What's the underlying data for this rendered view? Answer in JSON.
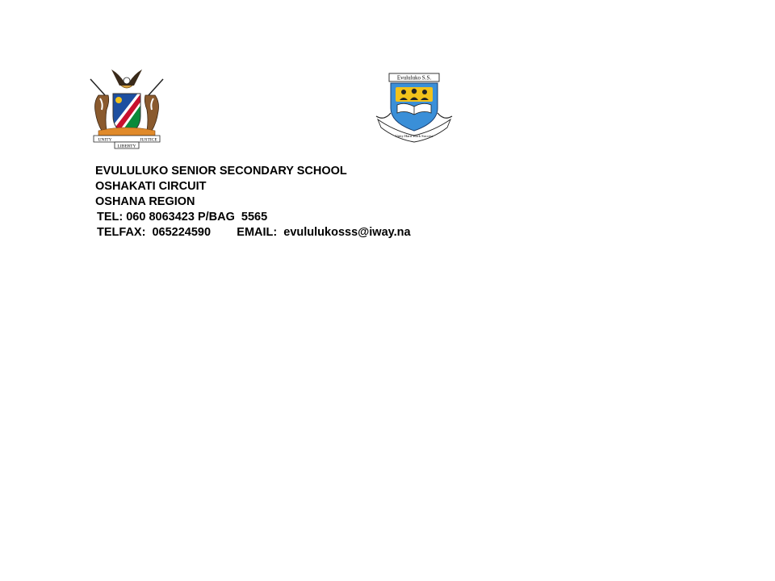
{
  "coat_of_arms": {
    "icon": "namibia-coat-of-arms-icon",
    "motto_left": "UNITY",
    "motto_center": "LIBERTY",
    "motto_right": "JUSTICE"
  },
  "school_crest": {
    "icon": "school-crest-icon",
    "banner": "Evululuko S.S.",
    "scroll_text": "Unity Hard Work Success"
  },
  "letterhead": {
    "school_name": "EVULULUKO SENIOR SECONDARY SCHOOL",
    "circuit": "OSHAKATI CIRCUIT",
    "region": "OSHANA REGION",
    "tel_line": "TEL: 060 8063423 P/BAG  5565",
    "telfax_line": "TELFAX:  065224590        EMAIL:  evululukosss@iway.na"
  },
  "colors": {
    "flag_blue": "#1d4fa0",
    "flag_red": "#c8102e",
    "flag_green": "#0a8a3a",
    "crest_blue": "#3a8fd8",
    "crest_yellow": "#f2c21b"
  }
}
